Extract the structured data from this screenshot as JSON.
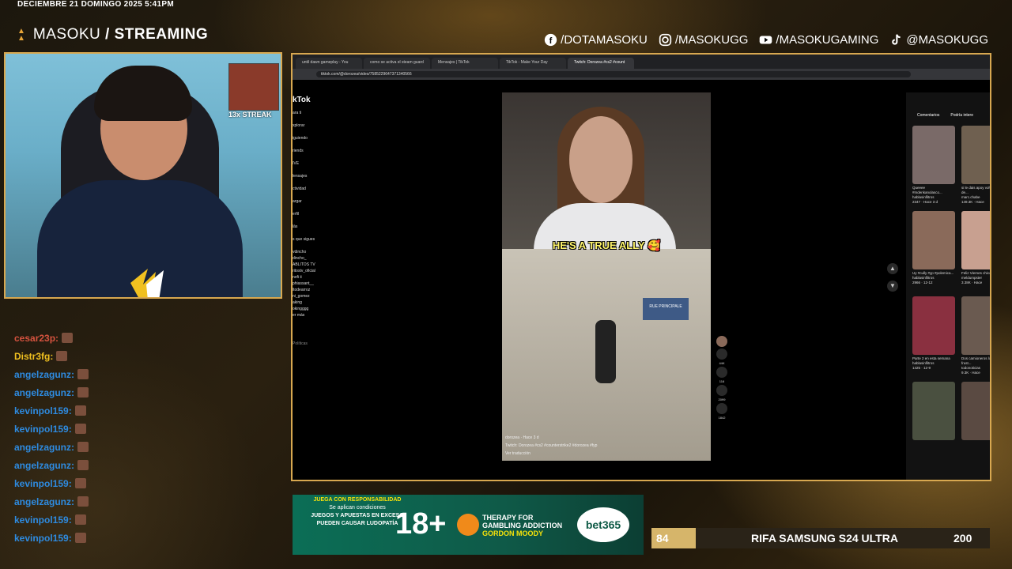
{
  "overlay": {
    "datetime": "DECIEMBRE 21 DOMINGO 2025 5:41PM",
    "brand_prefix": "MASOKU",
    "brand_suffix": "/ STREAMING",
    "socials": [
      {
        "icon": "facebook-icon",
        "handle": "/DOTAMASOKU"
      },
      {
        "icon": "instagram-icon",
        "handle": "/MASOKUGG"
      },
      {
        "icon": "youtube-icon",
        "handle": "/MASOKUGAMING"
      },
      {
        "icon": "tiktok-icon",
        "handle": "@MASOKUGG"
      }
    ],
    "accent_color": "#d8a850"
  },
  "webcam": {
    "streak_text": "13x STREAK"
  },
  "chat": {
    "messages": [
      {
        "user": "cesar23p:",
        "color": "#d7533f"
      },
      {
        "user": "Distr3fg:",
        "color": "#f0c020"
      },
      {
        "user": "angelzagunz:",
        "color": "#2e8be0"
      },
      {
        "user": "angelzagunz:",
        "color": "#2e8be0"
      },
      {
        "user": "kevinpol159:",
        "color": "#2e8be0"
      },
      {
        "user": "kevinpol159:",
        "color": "#2e8be0"
      },
      {
        "user": "angelzagunz:",
        "color": "#2e8be0"
      },
      {
        "user": "angelzagunz:",
        "color": "#2e8be0"
      },
      {
        "user": "kevinpol159:",
        "color": "#2e8be0"
      },
      {
        "user": "angelzagunz:",
        "color": "#2e8be0"
      },
      {
        "user": "kevinpol159:",
        "color": "#2e8be0"
      },
      {
        "user": "kevinpol159:",
        "color": "#2e8be0"
      }
    ]
  },
  "browser": {
    "tabs": [
      "until dawn gameplay - You",
      "como se activa el steam guard",
      "Mensajes | TikTok",
      "TikTok - Make Your Day",
      "Twitch: Dorozea #cs2 #count"
    ],
    "url": "tiktok.com/@dorozea/video/7585229647371340566",
    "tiktok": {
      "logo": "kTok",
      "nav": [
        "ara ti",
        "xplorar",
        "iguiendo",
        "riends",
        "IVE",
        "lensajes",
        "ctividad",
        "argar",
        "erfil",
        "lás"
      ],
      "following_title": "s que sigues",
      "following": [
        "vdincho",
        "dincho_",
        "ABLITOS TV",
        "ritostv_oficial",
        "nofi ii",
        "phiassant__",
        "ltodearroz",
        "ni_gomez",
        "aking",
        "okingggg"
      ],
      "more": "er más",
      "policies": "Políticas"
    },
    "video": {
      "caption": "HE'S A TRUE ALLY 🥰",
      "sign_text": "RUE PRINCIPALE",
      "author_time": "dorozea · Hace 3 d",
      "description": "Twitch: Dorozea #cs2 #counterstrike2 #dorozea #fyp",
      "translate": "Ver traducción",
      "counts": [
        "44K",
        "116",
        "2099",
        "1842"
      ]
    },
    "right_panel": {
      "tabs": [
        "Comentarios",
        "Podría intere"
      ],
      "cards": [
        {
          "title": "Queeee #mdenkanolasco...",
          "author": "hablasinfiltros",
          "stats": "2347 · Hace 3 d",
          "color": "#7a6a68"
        },
        {
          "title": "si le dais apoy volvemos de...",
          "author": "marc.chabe",
          "stats": "149.3K · Hace",
          "color": "#6f6050"
        },
        {
          "title": "Uy #cully #yp #polemica...",
          "author": "hablasinfiltros",
          "stats": "2966 · 12-12",
          "color": "#8a6a5a"
        },
        {
          "title": "Feliz Viernes chicos!!",
          "author": "meldumpster",
          "stats": "3.38K · Hace",
          "color": "#c8a090"
        },
        {
          "title": "Parte 2 en esta semana",
          "author": "hablasinfiltros",
          "stats": "1425 · 12-9",
          "color": "#8a3040"
        },
        {
          "title": "Dos camioneros lograron frust...",
          "author": "todonoticias",
          "stats": "9.3K · Hace",
          "color": "#6a5a50"
        },
        {
          "title": "",
          "author": "",
          "stats": "",
          "color": "#4a5040"
        },
        {
          "title": "",
          "author": "",
          "stats": "",
          "color": "#5a4a42"
        }
      ]
    }
  },
  "ad": {
    "line1": "JUEGA CON RESPONSABILIDAD",
    "line2": "Se aplican condiciones",
    "line3": "JUEGOS Y APUESTAS EN EXCESO",
    "line4": "PUEDEN CAUSAR LUDOPATÍA",
    "age": "18+",
    "therapy1": "THERAPY FOR",
    "therapy2": "GAMBLING ADDICTION",
    "therapy3": "GORDON MOODY",
    "brand": "bet365"
  },
  "raffle": {
    "left_number": "84",
    "title": "RIFA SAMSUNG S24 ULTRA",
    "right_number": "200"
  }
}
